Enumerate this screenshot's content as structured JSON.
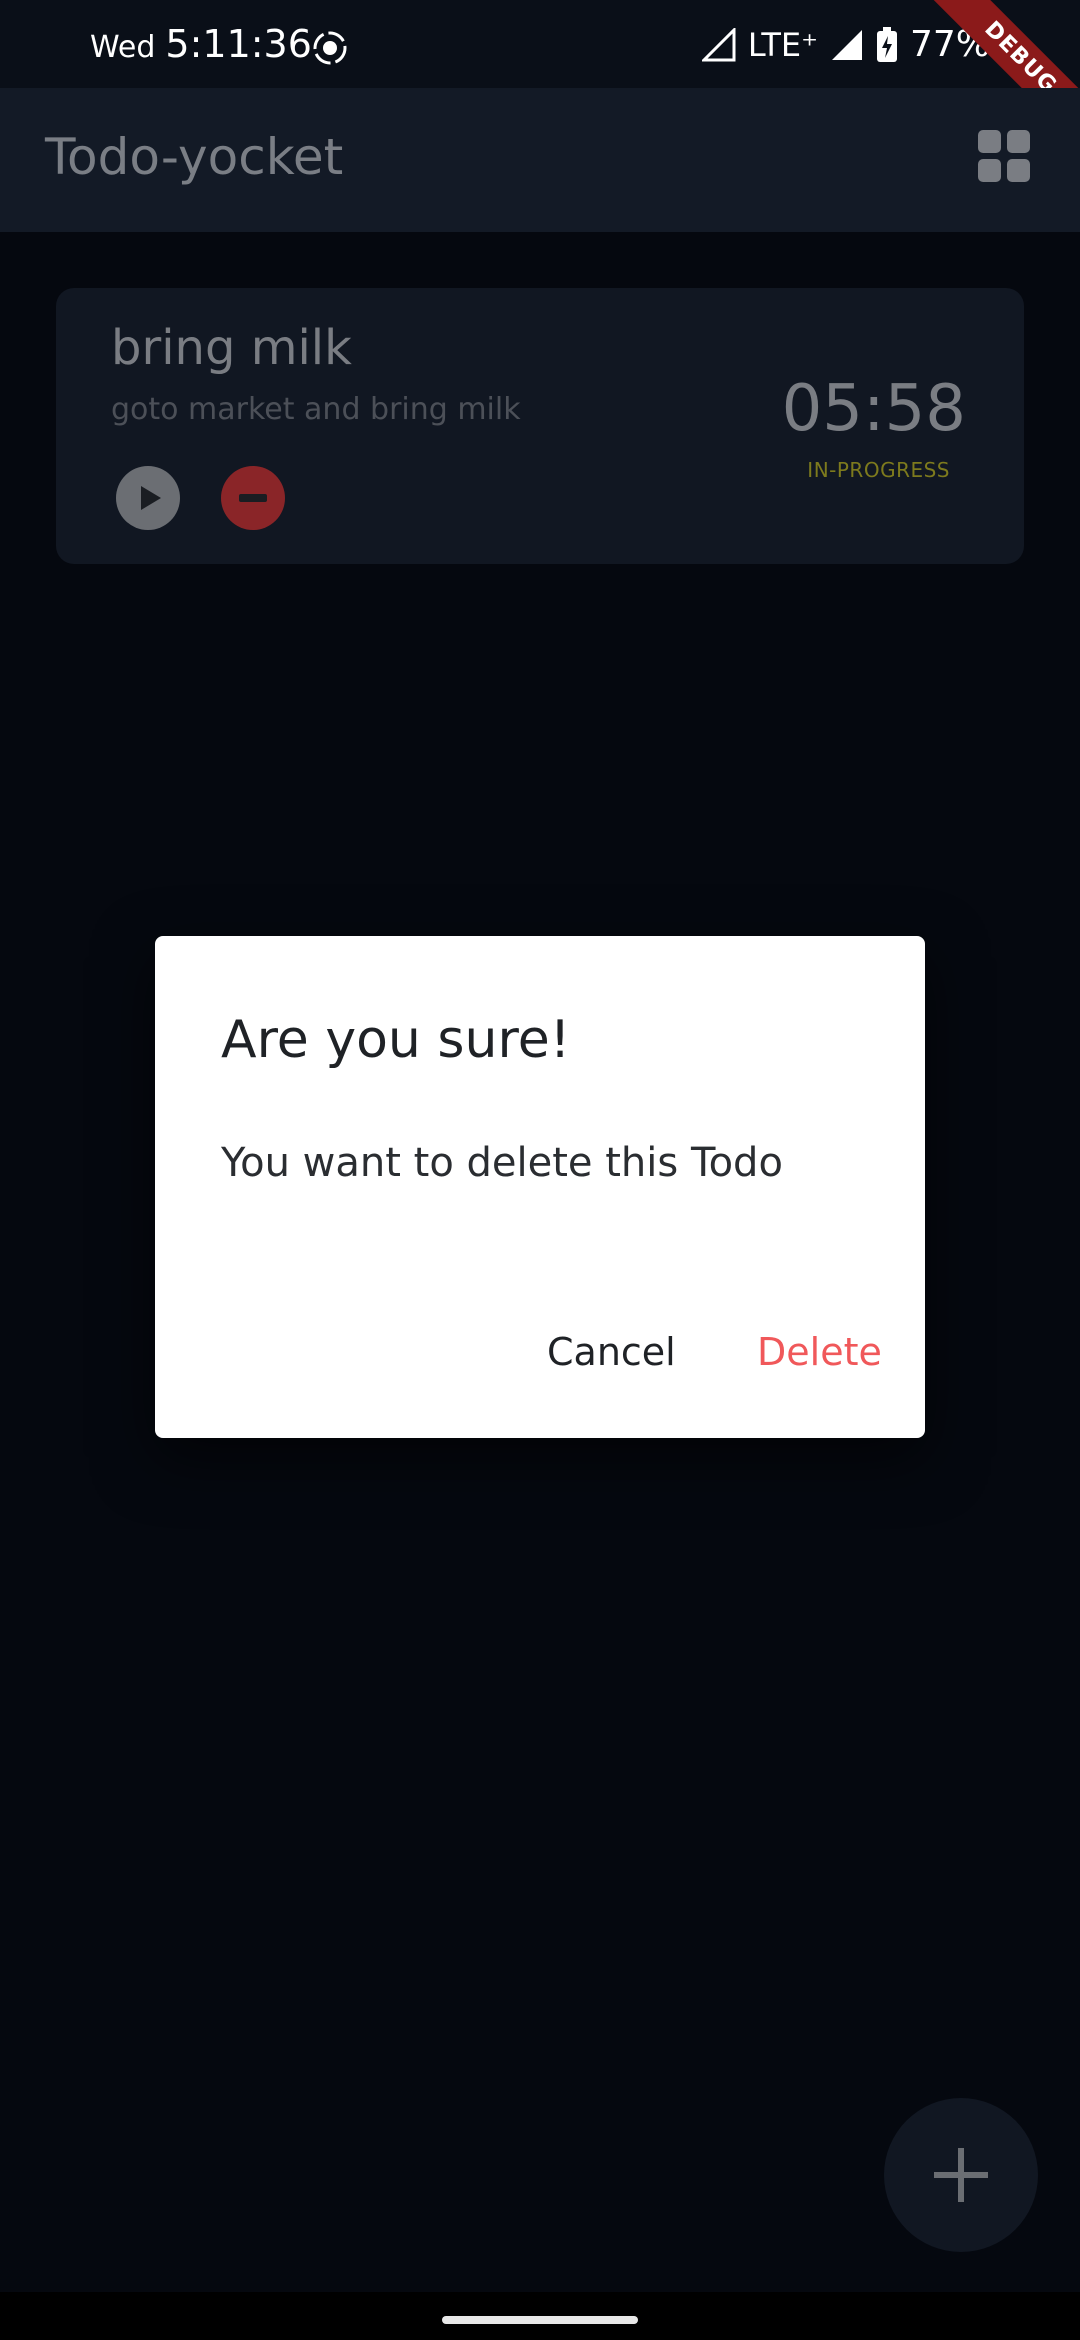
{
  "status_bar": {
    "day": "Wed",
    "time": "5:11:36",
    "network": "LTE⁺",
    "battery": "77%",
    "icons": [
      "screen-record-icon",
      "signal-icon",
      "battery-charging-icon"
    ]
  },
  "debug_banner": "DEBUG",
  "app_bar": {
    "title": "Todo-yocket",
    "view_toggle_icon": "grid-view-icon"
  },
  "todos": [
    {
      "title": "bring milk",
      "description": "goto market and bring milk",
      "timer": "05:58",
      "status": "IN-PROGRESS"
    }
  ],
  "dialog": {
    "title": "Are you sure!",
    "message": "You want to delete this Todo",
    "cancel_label": "Cancel",
    "delete_label": "Delete"
  },
  "fab": {
    "icon": "add-icon"
  },
  "colors": {
    "accent_delete": "#f0585a",
    "status_in_progress": "#7d7a1d",
    "background": "#05080f"
  }
}
